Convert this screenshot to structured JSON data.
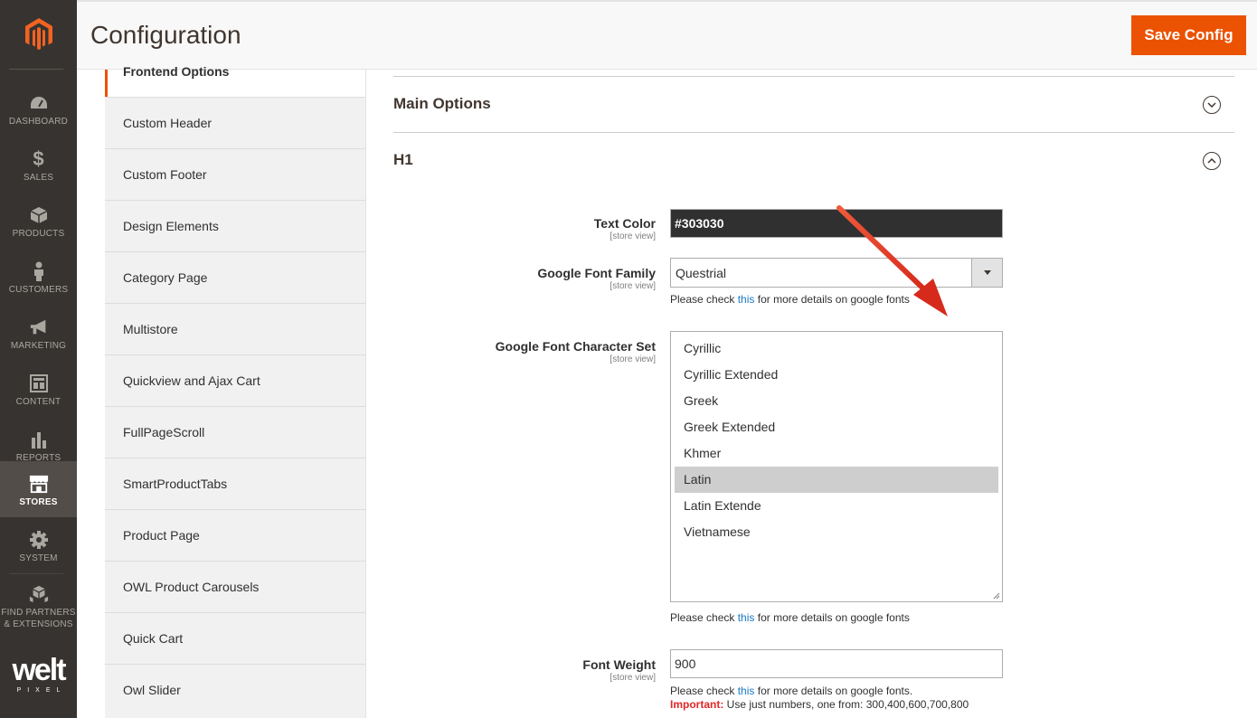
{
  "nav": {
    "items": [
      {
        "label": "DASHBOARD",
        "icon": "speedometer-icon"
      },
      {
        "label": "SALES",
        "icon": "dollar-icon"
      },
      {
        "label": "PRODUCTS",
        "icon": "cube-icon"
      },
      {
        "label": "CUSTOMERS",
        "icon": "person-icon"
      },
      {
        "label": "MARKETING",
        "icon": "megaphone-icon"
      },
      {
        "label": "CONTENT",
        "icon": "layout-icon"
      },
      {
        "label": "REPORTS",
        "icon": "bar-chart-icon"
      },
      {
        "label": "STORES",
        "icon": "storefront-icon"
      },
      {
        "label": "SYSTEM",
        "icon": "gear-icon"
      },
      {
        "label": "FIND PARTNERS & EXTENSIONS",
        "icon": "boxes-icon"
      }
    ],
    "active": "STORES",
    "brand_word": "welt",
    "brand_sub": "PIXEL"
  },
  "header": {
    "title": "Configuration",
    "save_label": "Save Config",
    "accent": "#eb5202"
  },
  "tabs": {
    "active_label": "Frontend Options",
    "items": [
      "Custom Header",
      "Custom Footer",
      "Design Elements",
      "Category Page",
      "Multistore",
      "Quickview and Ajax Cart",
      "FullPageScroll",
      "SmartProductTabs",
      "Product Page",
      "OWL Product Carousels",
      "Quick Cart",
      "Owl Slider"
    ]
  },
  "sections": {
    "main_options": "Main Options",
    "h1": "H1"
  },
  "fields": {
    "text_color": {
      "label": "Text Color",
      "scope": "[store view]",
      "value": "#303030"
    },
    "font_family": {
      "label": "Google Font Family",
      "scope": "[store view]",
      "value": "Questrial"
    },
    "charset": {
      "label": "Google Font Character Set",
      "scope": "[store view]",
      "options": [
        "Cyrillic",
        "Cyrillic Extended",
        "Greek",
        "Greek Extended",
        "Khmer",
        "Latin",
        "Latin Extende",
        "Vietnamese"
      ],
      "selected": "Latin"
    },
    "font_weight": {
      "label": "Font Weight",
      "scope": "[store view]",
      "value": "900"
    }
  },
  "notes": {
    "pre": "Please check ",
    "link": "this",
    "post": " for more details on google fonts",
    "post_period": " for more details on google fonts.",
    "important_label": "Important:",
    "important_text": " Use just numbers, one from: 300,400,600,700,800"
  }
}
